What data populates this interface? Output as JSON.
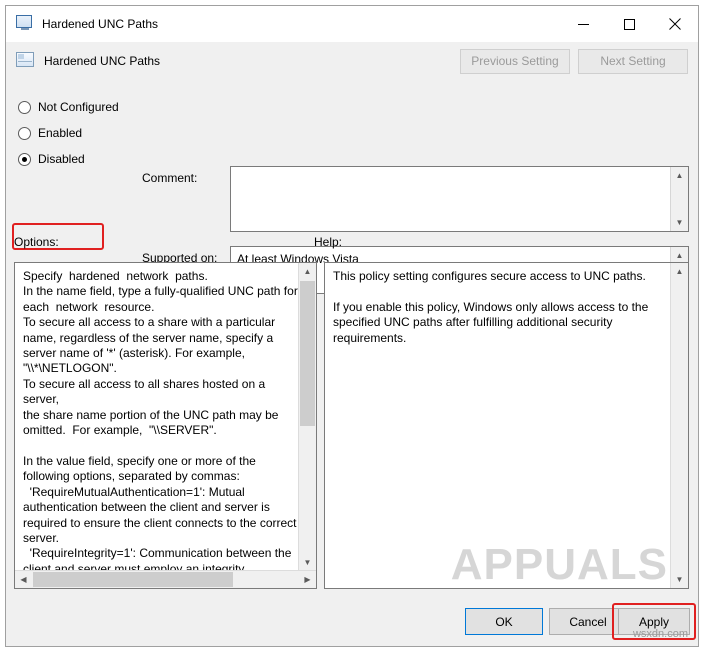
{
  "window": {
    "title": "Hardened UNC Paths",
    "icon": "monitor-icon",
    "buttons": {
      "minimize": "─",
      "maximize": "□",
      "close": "✕"
    }
  },
  "header": {
    "icon": "policy-icon",
    "title": "Hardened UNC Paths",
    "previous_setting": "Previous Setting",
    "next_setting": "Next Setting"
  },
  "settings": {
    "radios": [
      {
        "label": "Not Configured",
        "checked": false
      },
      {
        "label": "Enabled",
        "checked": false
      },
      {
        "label": "Disabled",
        "checked": true
      }
    ],
    "comment_label": "Comment:",
    "comment_value": "",
    "supported_label": "Supported on:",
    "supported_value": "At least Windows Vista"
  },
  "panels": {
    "options_label": "Options:",
    "help_label": "Help:",
    "options_text": "Specify  hardened  network  paths.\nIn the name field, type a fully-qualified UNC path for\neach  network  resource.\nTo secure all access to a share with a particular\nname, regardless of the server name, specify a\nserver name of '*' (asterisk). For example,\n\"\\\\*\\NETLOGON\".\nTo secure all access to all shares hosted on a server,\nthe share name portion of the UNC path may be\nomitted.  For example,  \"\\\\SERVER\".\n\nIn the value field, specify one or more of the\nfollowing options, separated by commas:\n  'RequireMutualAuthentication=1': Mutual\nauthentication between the client and server is\nrequired to ensure the client connects to the correct\nserver.\n  'RequireIntegrity=1': Communication between the\nclient and server must employ an integrity",
    "help_text": "This policy setting configures secure access to UNC paths.\n\nIf you enable this policy, Windows only allows access to the\nspecified UNC paths after fulfilling additional security\nrequirements."
  },
  "footer": {
    "ok": "OK",
    "cancel": "Cancel",
    "apply": "Apply"
  },
  "watermark": {
    "text": "APPUALS",
    "credit": "wsxdn.com"
  },
  "colors": {
    "highlight": "#e02020",
    "accent": "#0078d7"
  }
}
